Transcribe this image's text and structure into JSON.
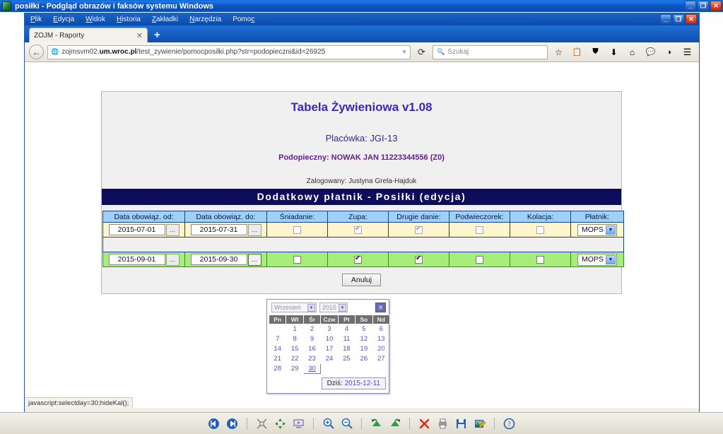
{
  "viewer": {
    "title": "posiłki - Podgląd obrazów i faksów systemu Windows",
    "window_buttons": {
      "minimize": "_",
      "maximize": "❐",
      "close": "✕"
    },
    "toolbar_icons": [
      "previous-image-icon",
      "next-image-icon",
      "best-fit-icon",
      "actual-size-icon",
      "slideshow-icon",
      "zoom-in-icon",
      "zoom-out-icon",
      "rotate-left-icon",
      "rotate-right-icon",
      "delete-icon",
      "print-icon",
      "save-icon",
      "edit-icon",
      "help-icon"
    ]
  },
  "browser": {
    "menu": [
      {
        "label": "Plik",
        "accel": "P"
      },
      {
        "label": "Edycja",
        "accel": "E"
      },
      {
        "label": "Widok",
        "accel": "W"
      },
      {
        "label": "Historia",
        "accel": "H"
      },
      {
        "label": "Zakładki",
        "accel": "Z"
      },
      {
        "label": "Narzędzia",
        "accel": "N"
      },
      {
        "label": "Pomoc",
        "accel": "c"
      }
    ],
    "window_buttons": {
      "minimize": "_",
      "maximize": "❐",
      "close": "✕"
    },
    "tab": {
      "title": "ZOJM - Raporty",
      "close": "✕"
    },
    "new_tab": "+",
    "back": "←",
    "url_prefix": "zojmsvm02.",
    "url_domain": "um.wroc.pl",
    "url_suffix": "/test_zywienie/pomocposilki.php?str=podopieczni&id=26925",
    "reload": "⟳",
    "search_placeholder": "Szukaj",
    "toolbar_icons": [
      "bookmark-star-icon",
      "reader-icon",
      "pocket-icon",
      "downloads-icon",
      "home-icon",
      "chat-icon",
      "sync-icon",
      "hamburger-menu-icon"
    ],
    "status_text": "javascript:selectday=30;hideKal();"
  },
  "page": {
    "title": "Tabela Żywieniowa v1.08",
    "placowka": "Placówka: JGI-13",
    "podopieczny": "Podopieczny: NOWAK JAN 11223344556 (Z0)",
    "zalogowany": "Zalogowany:  Justyna Grela-Hajduk",
    "section_title": "Dodatkowy płatnik - Posiłki (edycja)",
    "columns": [
      "Data obowiąz. od:",
      "Data obowiąz. do:",
      "Śniadanie:",
      "Zupa:",
      "Drugie danie:",
      "Podwieczorek:",
      "Kolacja:",
      "Płatnik:"
    ],
    "rows": [
      {
        "style": "yellow",
        "date_from": "2015-07-01",
        "date_to": "2015-07-31",
        "picker_label": "...",
        "sniadanie": false,
        "zupa": true,
        "drugie_danie": true,
        "podwieczorek": false,
        "kolacja": false,
        "platnik": "MOPS"
      },
      {
        "style": "green",
        "date_from": "2015-09-01",
        "date_to": "2015-09-30",
        "picker_label": "...",
        "sniadanie": false,
        "zupa": true,
        "drugie_danie": true,
        "podwieczorek": false,
        "kolacja": false,
        "platnik": "MOPS"
      }
    ],
    "cancel_button": "Anuluj"
  },
  "calendar": {
    "month": "Wrzesień",
    "year": "2015",
    "close": "✕",
    "weekdays": [
      "Pn",
      "Wt",
      "Śr",
      "Czw",
      "Pt",
      "So",
      "Nd"
    ],
    "weeks": [
      [
        "",
        "1",
        "2",
        "3",
        "4",
        "5",
        "6"
      ],
      [
        "7",
        "8",
        "9",
        "10",
        "11",
        "12",
        "13"
      ],
      [
        "14",
        "15",
        "16",
        "17",
        "18",
        "19",
        "20"
      ],
      [
        "21",
        "22",
        "23",
        "24",
        "25",
        "26",
        "27"
      ],
      [
        "28",
        "29",
        "30",
        "",
        "",
        "",
        ""
      ]
    ],
    "selected_day": "30",
    "today_label": "Dziś:",
    "today_value": "2015-12-11"
  }
}
